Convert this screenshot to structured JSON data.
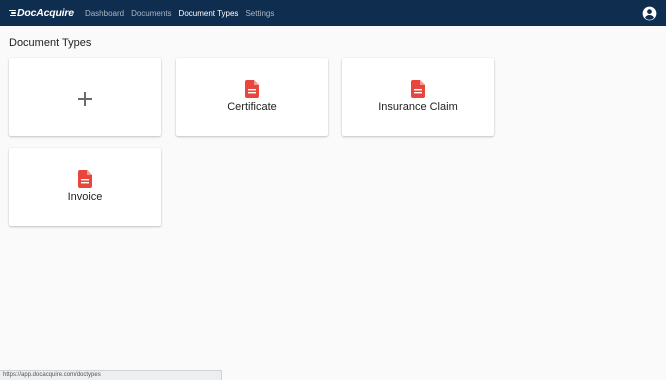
{
  "brand": {
    "name": "DocAcquire"
  },
  "nav": {
    "items": [
      {
        "label": "Dashboard"
      },
      {
        "label": "Documents"
      },
      {
        "label": "Document Types"
      },
      {
        "label": "Settings"
      }
    ],
    "active": "Document Types"
  },
  "page": {
    "title": "Document Types"
  },
  "cards": [
    {
      "type": "add",
      "icon": "plus-icon"
    },
    {
      "type": "doc",
      "label": "Certificate",
      "icon": "document-icon"
    },
    {
      "type": "doc",
      "label": "Insurance Claim",
      "icon": "document-icon"
    },
    {
      "type": "doc",
      "label": "Invoice",
      "icon": "document-icon"
    }
  ],
  "status": {
    "url": "https://app.docacquire.com/doctypes"
  },
  "colors": {
    "topbar": "#0f2d4f",
    "accent": "#e8453c",
    "background": "#fafafa"
  }
}
